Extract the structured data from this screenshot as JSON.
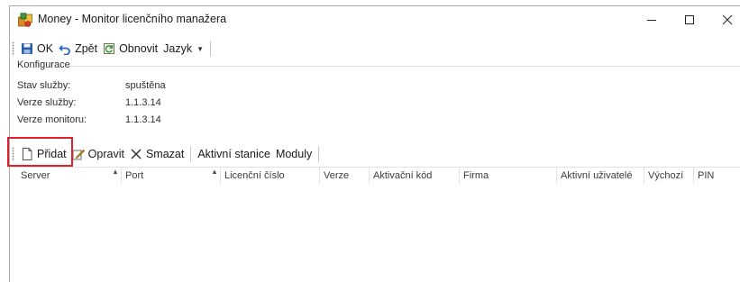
{
  "window": {
    "title": "Money - Monitor licenčního manažera",
    "icons": {
      "app": "money-app-icon",
      "minimize": "minimize-icon",
      "maximize": "maximize-icon",
      "close": "close-icon"
    }
  },
  "toolbar": {
    "ok_label": "OK",
    "back_label": "Zpět",
    "refresh_label": "Obnovit",
    "language_label": "Jazyk"
  },
  "config": {
    "group_title": "Konfigurace",
    "rows": [
      {
        "label": "Stav služby:",
        "value": "spuštěna"
      },
      {
        "label": "Verze služby:",
        "value": "1.1.3.14"
      },
      {
        "label": "Verze monitoru:",
        "value": "1.1.3.14"
      }
    ]
  },
  "list_toolbar": {
    "add_label": "Přidat",
    "edit_label": "Opravit",
    "delete_label": "Smazat",
    "active_stations_label": "Aktivní stanice",
    "modules_label": "Moduly"
  },
  "table": {
    "columns": [
      "Server",
      "Port",
      "Licenční číslo",
      "Verze",
      "Aktivační kód",
      "Firma",
      "Aktivní uživatelé",
      "Výchozí",
      "PIN"
    ],
    "rows": []
  },
  "colors": {
    "highlight": "#e0202a",
    "save_icon": "#2a5aa8"
  }
}
